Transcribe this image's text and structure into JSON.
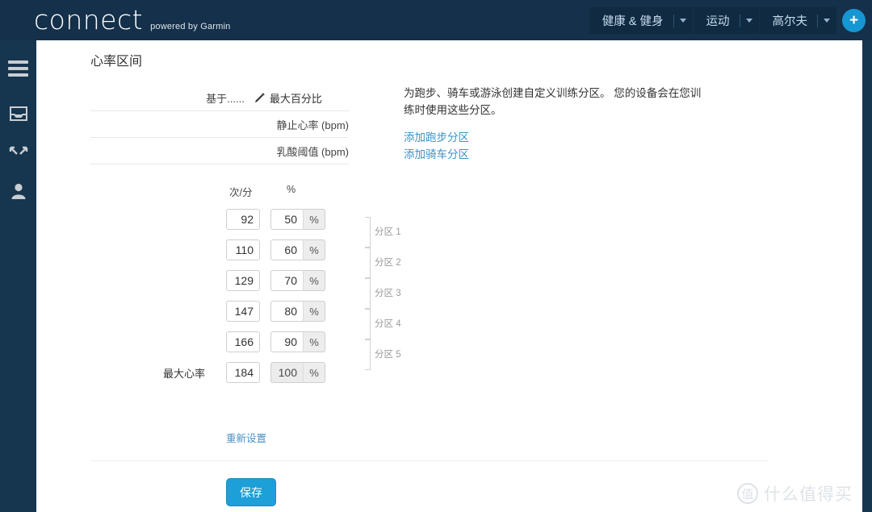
{
  "header": {
    "brand": "connect",
    "brand_sub": "powered by Garmin",
    "nav_items": [
      {
        "label": "健康 & 健身",
        "icon": "chevron-down-icon"
      },
      {
        "label": "运动",
        "icon": "chevron-down-icon"
      },
      {
        "label": "高尔夫",
        "icon": "chevron-down-icon"
      }
    ],
    "add_button": "+",
    "accent_color": "#1696d3",
    "bar_color": "#14304a"
  },
  "sidebar": {
    "items": [
      {
        "name": "menu-icon",
        "label": "菜单"
      },
      {
        "name": "inbox-icon",
        "label": "收件箱"
      },
      {
        "name": "connections-icon",
        "label": "连接"
      },
      {
        "name": "profile-icon",
        "label": "个人资料"
      }
    ]
  },
  "page": {
    "title": "心率区间"
  },
  "settings_rows": [
    {
      "label": "基于......",
      "value": "最大百分比",
      "icon": "pencil-icon"
    },
    {
      "label": "静止心率 (bpm)",
      "value": ""
    },
    {
      "label": "乳酸阈值 (bpm)",
      "value": ""
    }
  ],
  "zone_table": {
    "headers": {
      "bpm": "次/分",
      "percent": "%"
    },
    "percent_suffix": "%",
    "max_hr_label": "最大心率",
    "rows": [
      {
        "bpm": "92",
        "percent": "50",
        "disabled": false
      },
      {
        "bpm": "110",
        "percent": "60",
        "disabled": false
      },
      {
        "bpm": "129",
        "percent": "70",
        "disabled": false
      },
      {
        "bpm": "147",
        "percent": "80",
        "disabled": false
      },
      {
        "bpm": "166",
        "percent": "90",
        "disabled": false
      },
      {
        "bpm": "184",
        "percent": "100",
        "disabled": true
      }
    ],
    "zone_labels": [
      "分区 1",
      "分区 2",
      "分区 3",
      "分区 4",
      "分区 5"
    ],
    "reset_link": "重新设置"
  },
  "actions": {
    "save_label": "保存"
  },
  "info_panel": {
    "description": "为跑步、骑车或游泳创建自定义训练分区。 您的设备会在您训练时使用这些分区。",
    "links": [
      "添加跑步分区",
      "添加骑车分区"
    ]
  },
  "watermark": {
    "mark": "值",
    "text": "什么值得买"
  }
}
